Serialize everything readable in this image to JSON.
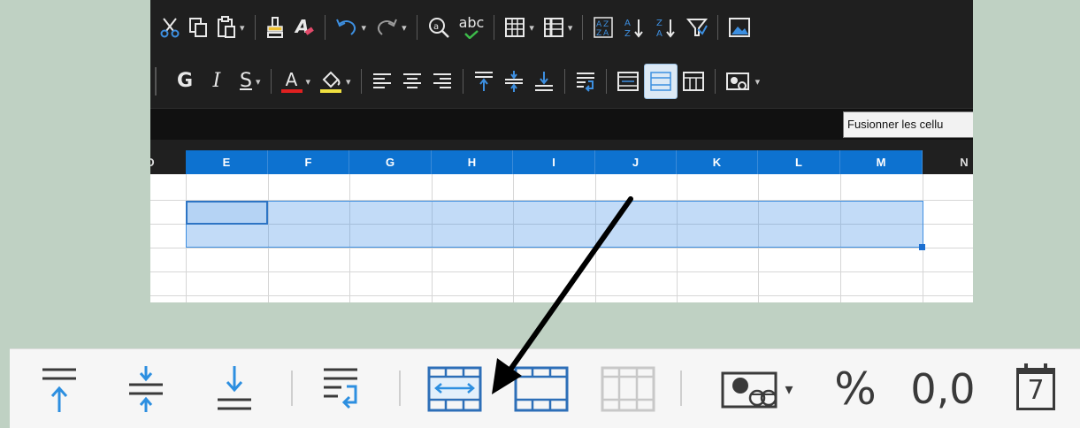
{
  "toolbar_top": {
    "spellcheck_label": "abc",
    "bold_label": "G",
    "italic_label": "I",
    "underline_label": "S",
    "font_color_label": "A",
    "dropdown_glyph": "▾"
  },
  "tooltip": {
    "text": "Fusionner les cellu"
  },
  "sheet": {
    "left_col_header_partial": "D",
    "columns": [
      "E",
      "F",
      "G",
      "H",
      "I",
      "J",
      "K",
      "L",
      "M"
    ],
    "right_col_header": "N"
  },
  "zoom_toolbar": {
    "percent_label": "%",
    "decimal_label": "0,0",
    "date_day": "7",
    "dropdown_glyph": "▾"
  },
  "colors": {
    "background": "#bfd1c3",
    "column_selected": "#0d72d0",
    "selection_fill": "#4090e6",
    "icon_blue": "#2d8fe0",
    "icon_dark": "#3a3a3a"
  }
}
